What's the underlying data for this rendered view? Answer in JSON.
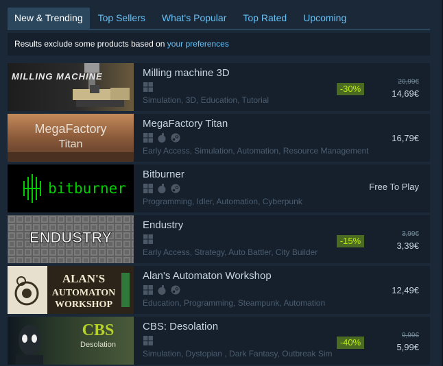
{
  "tabs": [
    {
      "label": "New & Trending"
    },
    {
      "label": "Top Sellers"
    },
    {
      "label": "What's Popular"
    },
    {
      "label": "Top Rated"
    },
    {
      "label": "Upcoming"
    }
  ],
  "notice": {
    "text": "Results exclude some products based on ",
    "link": "your preferences"
  },
  "capsule_text": {
    "milling": "MILLING MACHINE",
    "megafactory_a": "MegaFactory",
    "megafactory_b": "Titan",
    "bitburner": "bitburner",
    "endustry": "ENDUSTRY",
    "alans_a": "ALAN'S",
    "alans_b": "AUTOMATON",
    "alans_c": "WORKSHOP",
    "cbs_a": "CBS",
    "cbs_b": "Desolation"
  },
  "games": [
    {
      "name": "Milling machine 3D",
      "platforms": [
        "windows"
      ],
      "tags": "Simulation, 3D, Education, Tutorial",
      "discount": "-30%",
      "original_price": "20,99€",
      "final_price": "14,69€"
    },
    {
      "name": "MegaFactory Titan",
      "platforms": [
        "windows",
        "apple",
        "steam"
      ],
      "tags": "Early Access, Simulation, Automation, Resource Management",
      "price": "16,79€"
    },
    {
      "name": "Bitburner",
      "platforms": [
        "windows",
        "apple",
        "steam"
      ],
      "tags": "Programming, Idler, Automation, Cyberpunk",
      "price": "Free To Play"
    },
    {
      "name": "Endustry",
      "platforms": [
        "windows"
      ],
      "tags": "Early Access, Strategy, Auto Battler, City Builder",
      "discount": "-15%",
      "original_price": "3,99€",
      "final_price": "3,39€"
    },
    {
      "name": "Alan's Automaton Workshop",
      "platforms": [
        "windows",
        "apple",
        "steam"
      ],
      "tags": "Education, Programming, Steampunk, Automation",
      "price": "12,49€"
    },
    {
      "name": "CBS: Desolation",
      "platforms": [
        "windows"
      ],
      "tags": "Simulation, Dystopian , Dark Fantasy, Outbreak Sim",
      "discount": "-40%",
      "original_price": "9,99€",
      "final_price": "5,99€"
    }
  ],
  "colors": {
    "accent": "#67c1f5",
    "discount_bg": "#4c6b22",
    "discount_fg": "#beee11",
    "background": "#1b2838",
    "row_bg": "#16202d"
  }
}
